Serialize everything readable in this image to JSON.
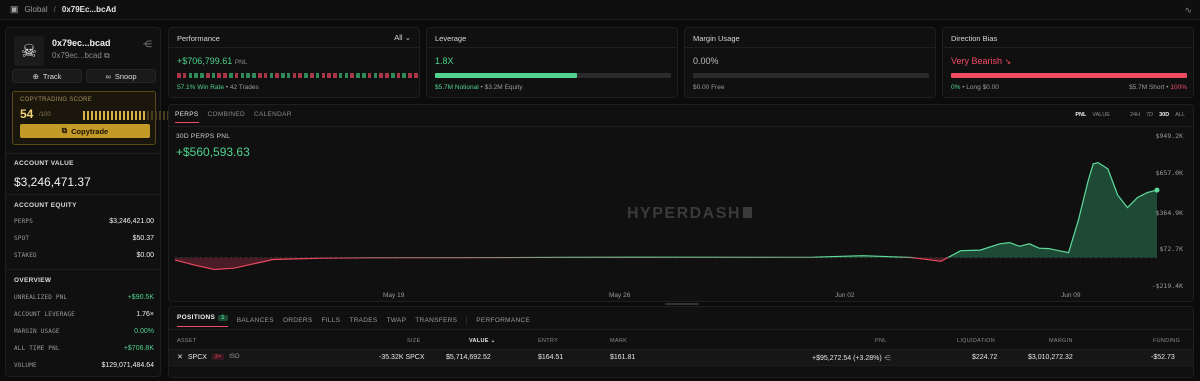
{
  "topbar": {
    "crumb_root": "Global",
    "crumb_sep": "/",
    "crumb_current": "0x79Ec...bcAd"
  },
  "profile": {
    "name": "0x79ec...bcad",
    "address": "0x79ec...bcad",
    "track_label": "Track",
    "snoop_label": "Snoop",
    "score_label": "COPYTRADING SCORE",
    "score": "54",
    "score_max": "/100",
    "score_level": 0.54,
    "copytrade_label": "Copytrade"
  },
  "account": {
    "value_label": "ACCOUNT VALUE",
    "value": "$3,246,471.37",
    "equity_label": "ACCOUNT EQUITY",
    "equity_rows": [
      {
        "k": "PERPS",
        "v": "$3,246,421.00"
      },
      {
        "k": "SPOT",
        "v": "$50.37"
      },
      {
        "k": "STAKED",
        "v": "$0.00"
      }
    ],
    "overview_label": "OVERVIEW",
    "overview_rows": [
      {
        "k": "UNREALIZED PNL",
        "v": "+$90.5K"
      },
      {
        "k": "ACCOUNT LEVERAGE",
        "v": "1.76×"
      },
      {
        "k": "MARGIN USAGE",
        "v": "0.00%"
      },
      {
        "k": "ALL TIME PNL",
        "v": "+$706.8K"
      },
      {
        "k": "VOLUME",
        "v": "$129,071,484.64"
      }
    ]
  },
  "performance": {
    "title": "Performance",
    "filter": "All",
    "pnl": "+$706,799.61",
    "pnl_unit": "PNL",
    "win_rate": "57.1% Win Rate",
    "trades": "• 42 Trades"
  },
  "leverage": {
    "title": "Leverage",
    "value": "1.8X",
    "level": 0.6,
    "notional": "$5.7M Notional",
    "equity": "• $3.2M Equity"
  },
  "margin": {
    "title": "Margin Usage",
    "value": "0.00%",
    "free": "$0.00 Free"
  },
  "bias": {
    "title": "Direction Bias",
    "value": "Very Bearish",
    "long_pct": "0%",
    "long": "• Long $0.00",
    "short": "$5.7M Short •",
    "short_pct": "100%"
  },
  "chart_tabs": [
    "PERPS",
    "COMBINED",
    "CALENDAR"
  ],
  "chart_modes": [
    "PNL",
    "VALUE"
  ],
  "chart_ranges": [
    "24H",
    "7D",
    "30D",
    "ALL"
  ],
  "chart_heading": "30D PERPS PNL",
  "chart_value": "+$560,593.63",
  "watermark": "HYPERDASH",
  "chart_data": {
    "type": "area",
    "title": "30D PERPS PNL",
    "ylim": [
      -219400,
      949200
    ],
    "yticks": [
      "$949.2K",
      "$657.0K",
      "$364.9K",
      "$72.7K",
      "-$219.4K"
    ],
    "xticks": [
      "May 19",
      "May 26",
      "Jun 02",
      "Jun 09"
    ],
    "x": [
      0,
      0.02,
      0.04,
      0.06,
      0.08,
      0.1,
      0.15,
      0.2,
      0.3,
      0.4,
      0.5,
      0.6,
      0.65,
      0.7,
      0.75,
      0.78,
      0.8,
      0.82,
      0.84,
      0.85,
      0.86,
      0.87,
      0.88,
      0.89,
      0.9,
      0.91,
      0.92,
      0.93,
      0.935,
      0.94,
      0.95,
      0.96,
      0.97,
      0.98,
      0.99,
      1
    ],
    "values": [
      -20000,
      -60000,
      -95000,
      -85000,
      -50000,
      -15000,
      -5000,
      -2000,
      -1000,
      2000,
      3000,
      2000,
      3000,
      15000,
      1000,
      -30000,
      55000,
      60000,
      110000,
      120000,
      90000,
      110000,
      75000,
      72000,
      55000,
      40000,
      300000,
      620000,
      750000,
      760000,
      710000,
      500000,
      400000,
      480000,
      520000,
      540000
    ],
    "grid": false,
    "legend": "none"
  },
  "positions": {
    "tabs": [
      "POSITIONS",
      "BALANCES",
      "ORDERS",
      "FILLS",
      "TRADES",
      "TWAP",
      "TRANSFERS",
      "PERFORMANCE"
    ],
    "count": "1",
    "headers": [
      "ASSET",
      "SIZE",
      "VALUE",
      "ENTRY",
      "MARK",
      "PNL",
      "LIQUIDATION",
      "MARGIN",
      "FUNDING"
    ],
    "row": {
      "asset": "SPCX",
      "leverage": "2×",
      "margin_mode": "ISO",
      "size": "-35.32K SPCX",
      "value": "$5,714,692.52",
      "entry": "$164.51",
      "mark": "$161.81",
      "pnl": "+$95,272.54 (+3.28%)",
      "liquidation": "$224.72",
      "margin": "$3,010,272.32",
      "funding": "-$52.73"
    }
  },
  "colors": {
    "green": "#4fd38e",
    "red": "#f04d64",
    "gold": "#c49a27"
  }
}
